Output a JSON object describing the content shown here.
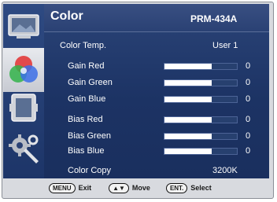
{
  "header": {
    "title": "Color",
    "model": "PRM-434A"
  },
  "sidebar": {
    "items": [
      {
        "icon": "picture-icon",
        "active": false
      },
      {
        "icon": "rgb-color-icon",
        "active": true
      },
      {
        "icon": "display-icon",
        "active": false
      },
      {
        "icon": "settings-tools-icon",
        "active": false
      }
    ]
  },
  "menu": {
    "color_temp": {
      "label": "Color Temp.",
      "value": "User 1"
    },
    "gain_red": {
      "label": "Gain Red",
      "value": "0",
      "level": 0.65
    },
    "gain_green": {
      "label": "Gain Green",
      "value": "0",
      "level": 0.65
    },
    "gain_blue": {
      "label": "Gain Blue",
      "value": "0",
      "level": 0.65
    },
    "bias_red": {
      "label": "Bias Red",
      "value": "0",
      "level": 0.65
    },
    "bias_green": {
      "label": "Bias Green",
      "value": "0",
      "level": 0.65
    },
    "bias_blue": {
      "label": "Bias Blue",
      "value": "0",
      "level": 0.65
    },
    "color_copy": {
      "label": "Color Copy",
      "value": "3200K"
    }
  },
  "footer": {
    "menu_key": "MENU",
    "menu_action": "Exit",
    "move_key": "▲▼",
    "move_action": "Move",
    "ent_key": "ENT.",
    "ent_action": "Select"
  },
  "colors": {
    "panel": "#1c3364",
    "sidebar": "#2e4a82",
    "highlight": "#d8dadf"
  }
}
